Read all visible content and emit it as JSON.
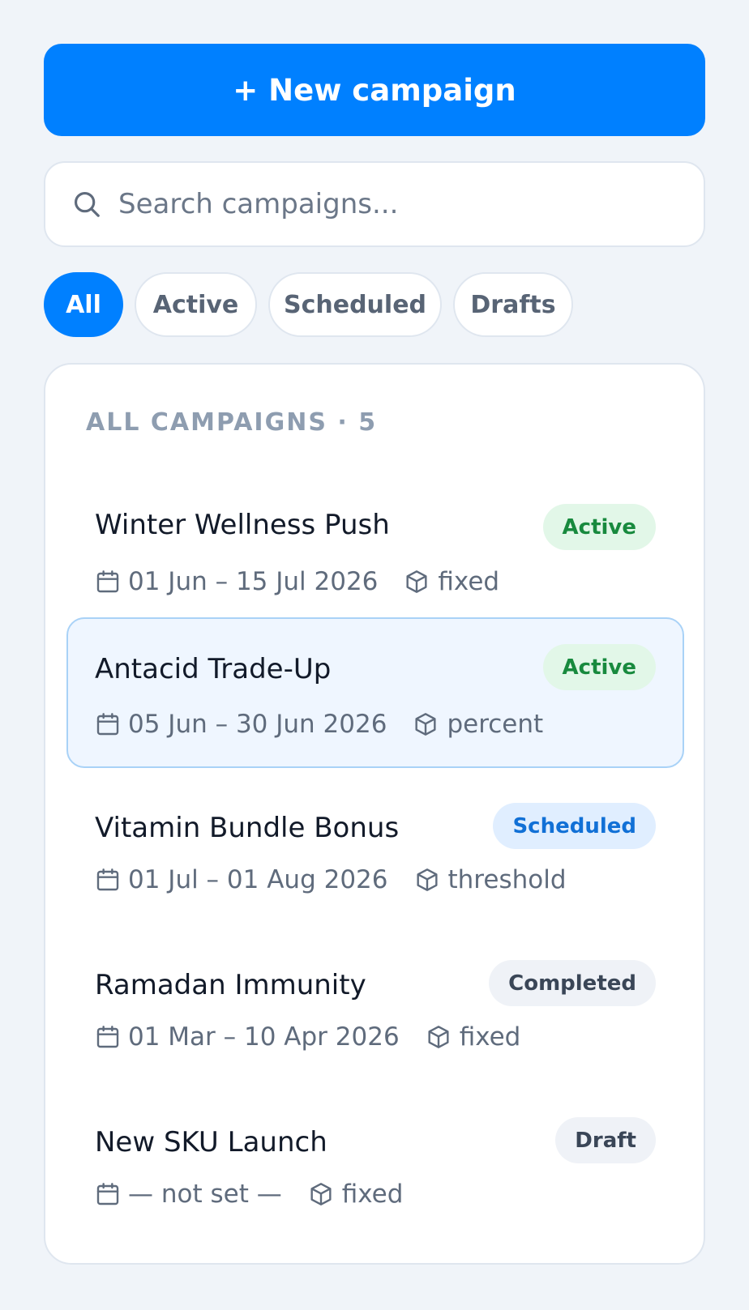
{
  "new_button": {
    "label": "+ New campaign"
  },
  "search": {
    "placeholder": "Search campaigns...",
    "value": ""
  },
  "filters": [
    {
      "label": "All",
      "selected": true
    },
    {
      "label": "Active",
      "selected": false
    },
    {
      "label": "Scheduled",
      "selected": false
    },
    {
      "label": "Drafts",
      "selected": false
    }
  ],
  "list": {
    "heading": "ALL CAMPAIGNS · 5",
    "items": [
      {
        "name": "Winter Wellness Push",
        "status": "Active",
        "dates": "01 Jun – 15 Jul 2026",
        "type": "fixed",
        "selected": false
      },
      {
        "name": "Antacid Trade-Up",
        "status": "Active",
        "dates": "05 Jun – 30 Jun 2026",
        "type": "percent",
        "selected": true
      },
      {
        "name": "Vitamin Bundle Bonus",
        "status": "Scheduled",
        "dates": "01 Jul – 01 Aug 2026",
        "type": "threshold",
        "selected": false
      },
      {
        "name": "Ramadan Immunity",
        "status": "Completed",
        "dates": "01 Mar – 10 Apr 2026",
        "type": "fixed",
        "selected": false
      },
      {
        "name": "New SKU Launch",
        "status": "Draft",
        "dates": "— not set —",
        "type": "fixed",
        "selected": false
      }
    ]
  },
  "icons": {
    "search": "search-icon",
    "date": "calendar-icon",
    "type": "cube-icon"
  },
  "colors": {
    "accent": "#0080ff",
    "active_badge": "#e2f7e8",
    "active_text": "#188a3e",
    "scheduled_badge": "#e0eeff",
    "scheduled_text": "#1170d6",
    "neutral_badge": "#eff2f7",
    "neutral_text": "#3a4657",
    "selected_row": "#eff6ff",
    "selected_border": "#a9d2f7"
  }
}
